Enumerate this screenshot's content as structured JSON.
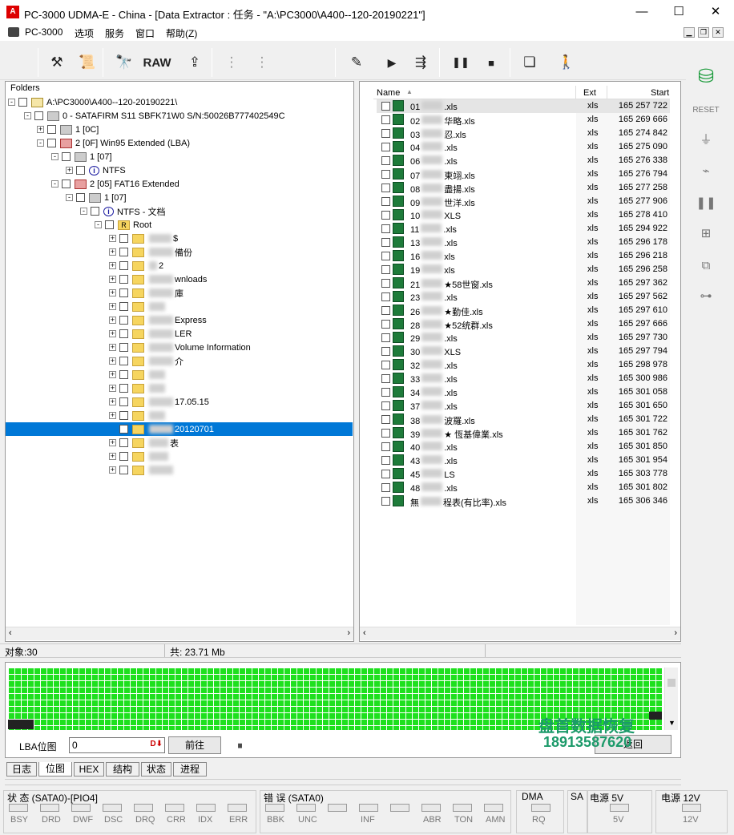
{
  "window": {
    "title": "PC-3000 UDMA-E - China - [Data Extractor : 任务 - \"A:\\PC3000\\A400--120-20190221\"]",
    "min": "—",
    "max": "☐",
    "close": "✕"
  },
  "menu": [
    "PC-3000",
    "选项",
    "服务",
    "窗口",
    "帮助(Z)"
  ],
  "toolbar": {
    "raw_label": "RAW"
  },
  "folders": {
    "header": "Folders",
    "nodes": [
      {
        "label": "A:\\PC3000\\A400--120-20190221\\"
      },
      {
        "label": "0 - SATAFIRM   S11 SBFK71W0 S/N:50026B777402549C"
      },
      {
        "label": "1 [0C]"
      },
      {
        "label": "2 [0F] Win95 Extended  (LBA)"
      },
      {
        "label": "1 [07]"
      },
      {
        "label": "NTFS"
      },
      {
        "label": "2 [05] FAT16 Extended"
      },
      {
        "label": "1 [07]"
      },
      {
        "label": "NTFS - 文档"
      },
      {
        "label": "Root"
      },
      {
        "label": "$"
      },
      {
        "label": "備份"
      },
      {
        "label": "2"
      },
      {
        "label": "wnloads"
      },
      {
        "label": "庫"
      },
      {
        "label": ""
      },
      {
        "label": "Express"
      },
      {
        "label": "LER"
      },
      {
        "label": "Volume Information"
      },
      {
        "label": "介"
      },
      {
        "label": ""
      },
      {
        "label": ""
      },
      {
        "label": "17.05.15"
      },
      {
        "label": ""
      },
      {
        "label": "20120701"
      },
      {
        "label": "表"
      },
      {
        "label": ""
      },
      {
        "label": ""
      }
    ]
  },
  "files": {
    "col_name": "Name",
    "col_ext": "Ext",
    "col_start": "Start",
    "rows": [
      {
        "name": "01",
        "suffix": ".xls",
        "ext": "xls",
        "start": "165 257 722"
      },
      {
        "name": "02",
        "suffix": "华略.xls",
        "ext": "xls",
        "start": "165 269 666"
      },
      {
        "name": "03",
        "suffix": "忍.xls",
        "ext": "xls",
        "start": "165 274 842"
      },
      {
        "name": "04",
        "suffix": ".xls",
        "ext": "xls",
        "start": "165 275 090"
      },
      {
        "name": "06",
        "suffix": ".xls",
        "ext": "xls",
        "start": "165 276 338"
      },
      {
        "name": "07",
        "suffix": "東翊.xls",
        "ext": "xls",
        "start": "165 276 794"
      },
      {
        "name": "08",
        "suffix": "盡揚.xls",
        "ext": "xls",
        "start": "165 277 258"
      },
      {
        "name": "09",
        "suffix": "世洋.xls",
        "ext": "xls",
        "start": "165 277 906"
      },
      {
        "name": "10",
        "suffix": "XLS",
        "ext": "xls",
        "start": "165 278 410"
      },
      {
        "name": "11",
        "suffix": ".xls",
        "ext": "xls",
        "start": "165 294 922"
      },
      {
        "name": "13",
        "suffix": ".xls",
        "ext": "xls",
        "start": "165 296 178"
      },
      {
        "name": "16",
        "suffix": "xls",
        "ext": "xls",
        "start": "165 296 218"
      },
      {
        "name": "19",
        "suffix": "xls",
        "ext": "xls",
        "start": "165 296 258"
      },
      {
        "name": "21",
        "suffix": "★58世窗.xls",
        "ext": "xls",
        "start": "165 297 362"
      },
      {
        "name": "23",
        "suffix": ".xls",
        "ext": "xls",
        "start": "165 297 562"
      },
      {
        "name": "26",
        "suffix": "★勤佳.xls",
        "ext": "xls",
        "start": "165 297 610"
      },
      {
        "name": "28",
        "suffix": "★52统群.xls",
        "ext": "xls",
        "start": "165 297 666"
      },
      {
        "name": "29",
        "suffix": ".xls",
        "ext": "xls",
        "start": "165 297 730"
      },
      {
        "name": "30",
        "suffix": "XLS",
        "ext": "xls",
        "start": "165 297 794"
      },
      {
        "name": "32",
        "suffix": ".xls",
        "ext": "xls",
        "start": "165 298 978"
      },
      {
        "name": "33",
        "suffix": ".xls",
        "ext": "xls",
        "start": "165 300 986"
      },
      {
        "name": "34",
        "suffix": ".xls",
        "ext": "xls",
        "start": "165 301 058"
      },
      {
        "name": "37",
        "suffix": ".xls",
        "ext": "xls",
        "start": "165 301 650"
      },
      {
        "name": "38",
        "suffix": "波羅.xls",
        "ext": "xls",
        "start": "165 301 722"
      },
      {
        "name": "39",
        "suffix": "★ 恆基偉業.xls",
        "ext": "xls",
        "start": "165 301 762"
      },
      {
        "name": "40",
        "suffix": ".xls",
        "ext": "xls",
        "start": "165 301 850"
      },
      {
        "name": "43",
        "suffix": ".xls",
        "ext": "xls",
        "start": "165 301 954"
      },
      {
        "name": "45",
        "suffix": "LS",
        "ext": "xls",
        "start": "165 303 778"
      },
      {
        "name": "48",
        "suffix": ".xls",
        "ext": "xls",
        "start": "165 301 802"
      },
      {
        "name": "無",
        "suffix": "程表(有比率).xls",
        "ext": "xls",
        "start": "165 306 346"
      }
    ]
  },
  "status": {
    "objects": "对象:30",
    "total": "共: 23.71 Mb"
  },
  "lba": {
    "label": "LBA位图",
    "value": "0",
    "go_button": "前往",
    "pause": "⏸",
    "watermark_name": "盘首数据恢复",
    "watermark_phone": "18913587620",
    "right_button": "返回"
  },
  "tabs": [
    "日志",
    "位图",
    "HEX",
    "结构",
    "状态",
    "进程"
  ],
  "leds": {
    "status_label": "状 态 (SATA0)-[PIO4]",
    "status_leds": [
      "BSY",
      "DRD",
      "DWF",
      "DSC",
      "DRQ",
      "CRR",
      "IDX",
      "ERR"
    ],
    "error_label": "错 误 (SATA0)",
    "error_leds": [
      "BBK",
      "UNC",
      "",
      "INF",
      "",
      "ABR",
      "TON",
      "AMN"
    ],
    "dma_label": "DMA",
    "dma_leds": [
      "RQ"
    ],
    "sa_label": "SA",
    "p5_label": "电源 5V",
    "p5_leds": [
      "5V"
    ],
    "p12_label": "电源 12V",
    "p12_leds": [
      "12V"
    ]
  }
}
